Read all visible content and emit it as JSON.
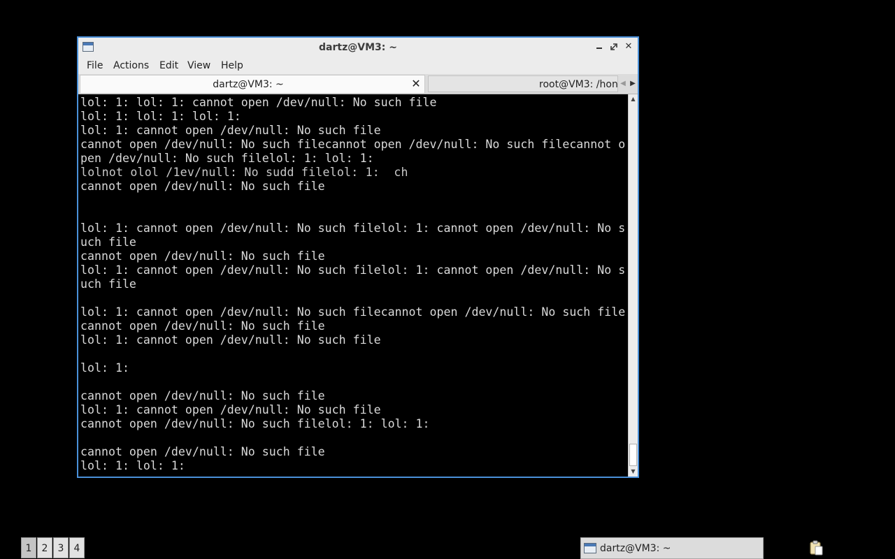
{
  "window": {
    "title": "dartz@VM3: ~",
    "icon": "terminal-window-icon",
    "controls": {
      "minimize": "minimize-icon",
      "maximize": "maximize-icon",
      "close": "✕"
    }
  },
  "menubar": {
    "items": [
      "File",
      "Actions",
      "Edit",
      "View",
      "Help"
    ]
  },
  "tabs": [
    {
      "label": "dartz@VM3: ~",
      "active": true,
      "close": "✕"
    },
    {
      "label": "root@VM3: /hon",
      "active": false
    }
  ],
  "tab_scroll": {
    "left": "◀",
    "right": "▶"
  },
  "terminal": {
    "lines": [
      "lol: 1: lol: 1: cannot open /dev/null: No such file",
      "lol: 1: lol: 1: lol: 1:",
      "lol: 1: cannot open /dev/null: No such file",
      "cannot open /dev/null: No such filecannot open /dev/null: No such filecannot o",
      "pen /dev/null: No such filelol: 1: lol: 1:",
      "lolnot olol /1ev/null: No sudd filelol: 1:  ch ",
      "cannot open /dev/null: No such file",
      "",
      "",
      "lol: 1: cannot open /dev/null: No such filelol: 1: cannot open /dev/null: No s",
      "uch file",
      "cannot open /dev/null: No such file",
      "lol: 1: cannot open /dev/null: No such filelol: 1: cannot open /dev/null: No s",
      "uch file",
      "",
      "lol: 1: cannot open /dev/null: No such filecannot open /dev/null: No such file",
      "cannot open /dev/null: No such file",
      "lol: 1: cannot open /dev/null: No such file",
      "",
      "lol: 1:",
      "",
      "cannot open /dev/null: No such file",
      "lol: 1: cannot open /dev/null: No such file",
      "cannot open /dev/null: No such filelol: 1: lol: 1:",
      "",
      "cannot open /dev/null: No such file",
      "lol: 1: lol: 1:"
    ],
    "garbled_line_index": 5,
    "scroll_position": 0.97
  },
  "scrollbar": {
    "up": "▲",
    "down": "▼"
  },
  "taskbar": {
    "desktops": [
      "1",
      "2",
      "3",
      "4"
    ],
    "active_desktop": "1",
    "task": {
      "label": "dartz@VM3: ~",
      "icon": "terminal-window-icon"
    },
    "tray": {
      "icon": "clipboard-icon"
    }
  },
  "colors": {
    "background": "#000000",
    "window_border": "#4a90d9",
    "terminal_fg": "#d9d9d9",
    "chrome": "#ececec"
  }
}
